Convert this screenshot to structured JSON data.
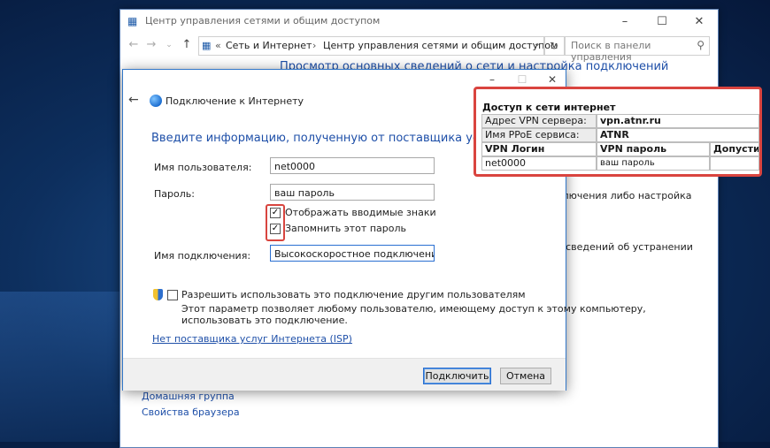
{
  "background_window": {
    "title": "Центр управления сетями и общим доступом",
    "minimize_icon": "–",
    "maximize_icon": "☐",
    "close_icon": "✕",
    "address": {
      "chevrons": "«",
      "crumb1": "Сеть и Интернет",
      "separator": "›",
      "crumb2": "Центр управления сетями и общим доступом"
    },
    "search_placeholder": "Поиск в панели управления",
    "heading": "Просмотр основных сведений о сети и настройка подключений",
    "right_text1": "ключения либо настройка",
    "right_text2": "я сведений об устранении",
    "bottom_links": [
      "Домашняя группа",
      "Свойства браузера"
    ]
  },
  "dialog": {
    "title": "Подключение к Интернету",
    "heading": "Введите информацию, полученную от поставщика услуг Интер",
    "fields": {
      "username_label": "Имя пользователя:",
      "username_value": "net0000",
      "password_label": "Пароль:",
      "password_value": "ваш пароль",
      "show_chars_label": "Отображать вводимые знаки",
      "remember_label": "Запомнить этот пароль",
      "connection_name_label": "Имя подключения:",
      "connection_name_value": "Высокоскоростное подключение"
    },
    "checkmark": "✓",
    "allow_others_label": "Разрешить использовать это подключение другим пользователям",
    "allow_desc_line1": "Этот параметр позволяет любому пользователю, имеющему доступ к этому компьютеру,",
    "allow_desc_line2": "использовать это подключение.",
    "isp_link": "Нет поставщика услуг Интернета (ISP)",
    "connect_button": "Подключить",
    "cancel_button": "Отмена"
  },
  "info_card": {
    "title": "Доступ к сети интернет",
    "vpn_server_label": "Адрес VPN сервера:",
    "vpn_server_value": "vpn.atnr.ru",
    "pppoe_label": "Имя PPoE сервиса:",
    "pppoe_value": "ATNR",
    "headers": [
      "VPN Логин",
      "VPN пароль",
      "Допусти"
    ],
    "row": [
      "net0000",
      "ваш пароль",
      ""
    ]
  },
  "colors": {
    "accent_blue": "#1e4fa8",
    "highlight_red": "#d9443f"
  }
}
